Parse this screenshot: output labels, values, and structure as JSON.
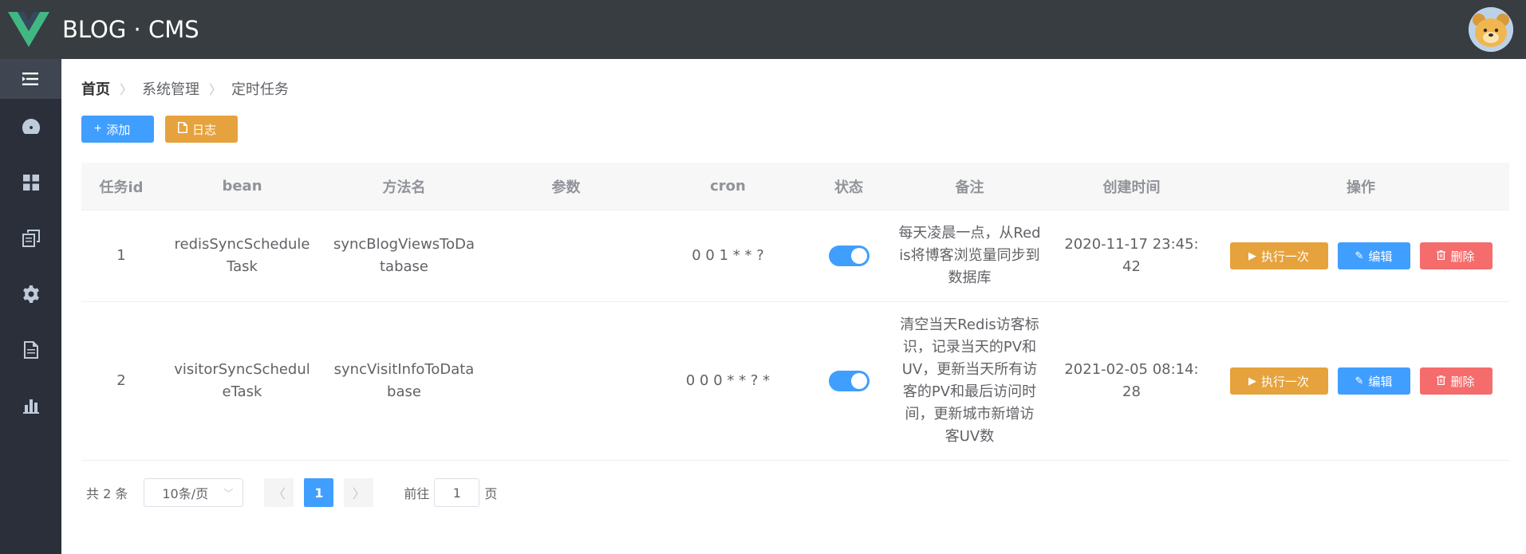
{
  "header": {
    "brand": "BLOG · CMS"
  },
  "sidebar": {
    "items": [
      {
        "icon": "menu-collapse-icon",
        "active": true
      },
      {
        "icon": "dashboard-icon"
      },
      {
        "icon": "grid-icon"
      },
      {
        "icon": "copy-icon"
      },
      {
        "icon": "gear-icon"
      },
      {
        "icon": "document-icon"
      },
      {
        "icon": "bar-chart-icon"
      }
    ]
  },
  "breadcrumb": [
    "首页",
    "系统管理",
    "定时任务"
  ],
  "toolbar": {
    "add_label": "添加",
    "log_label": "日志"
  },
  "table": {
    "headers": [
      "任务id",
      "bean",
      "方法名",
      "参数",
      "cron",
      "状态",
      "备注",
      "创建时间",
      "操作"
    ],
    "rows": [
      {
        "id": "1",
        "bean": "redisSyncScheduleTask",
        "method": "syncBlogViewsToDatabase",
        "params": "",
        "cron": "0 0 1 * * ?",
        "status": true,
        "remark": "每天凌晨一点，从Redis将博客浏览量同步到数据库",
        "created": "2020-11-17 23:45:42"
      },
      {
        "id": "2",
        "bean": "visitorSyncScheduleTask",
        "method": "syncVisitInfoToDatabase",
        "params": "",
        "cron": "0 0 0 * * ? *",
        "status": true,
        "remark": "清空当天Redis访客标识，记录当天的PV和UV，更新当天所有访客的PV和最后访问时间，更新城市新增访客UV数",
        "created": "2021-02-05 08:14:28"
      }
    ],
    "ops": {
      "run_label": "执行一次",
      "edit_label": "编辑",
      "delete_label": "删除"
    }
  },
  "pagination": {
    "total_text": "共 2 条",
    "page_size": "10条/页",
    "current_page": "1",
    "goto_label": "前往",
    "goto_value": "1",
    "page_suffix": "页"
  }
}
